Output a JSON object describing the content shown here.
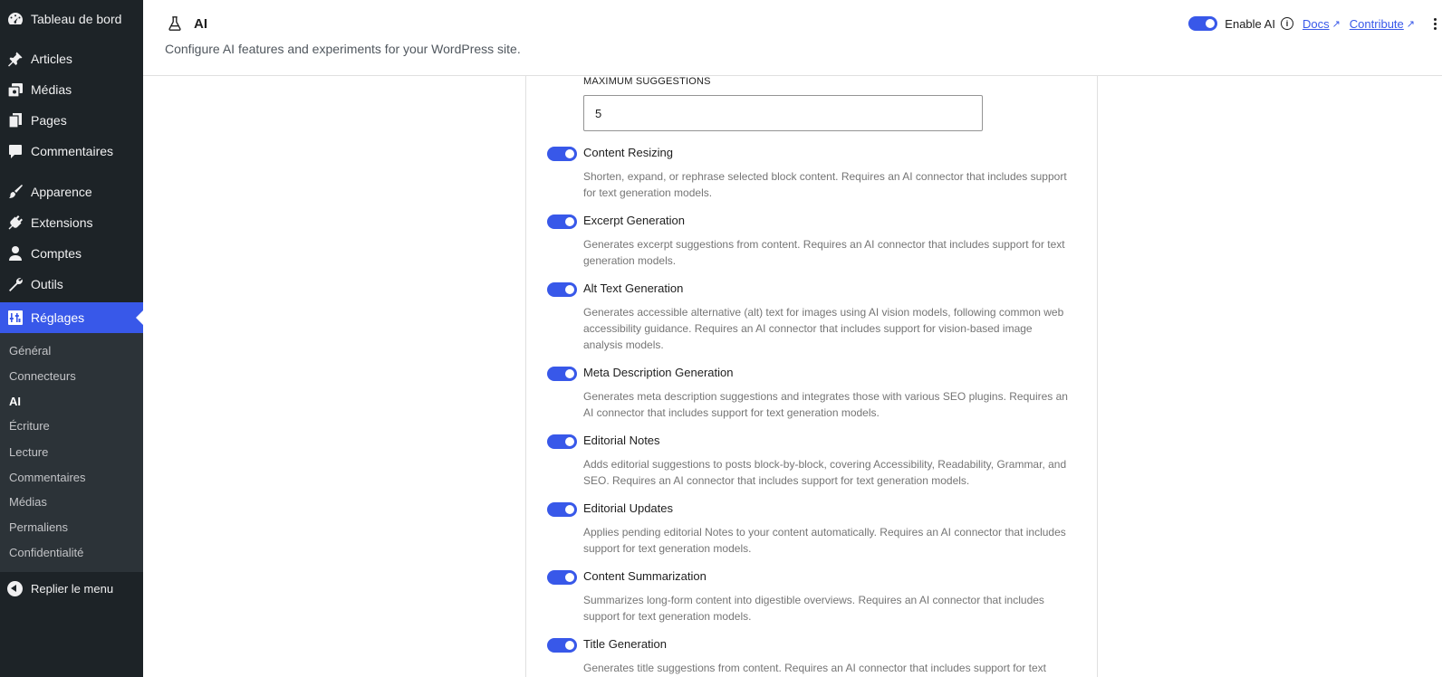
{
  "sidebar": {
    "items": [
      {
        "label": "Tableau de bord",
        "icon": "dashboard-icon"
      },
      {
        "label": "Articles",
        "icon": "pin-icon"
      },
      {
        "label": "Médias",
        "icon": "media-icon"
      },
      {
        "label": "Pages",
        "icon": "pages-icon"
      },
      {
        "label": "Commentaires",
        "icon": "comment-icon"
      },
      {
        "label": "Apparence",
        "icon": "brush-icon"
      },
      {
        "label": "Extensions",
        "icon": "plugin-icon"
      },
      {
        "label": "Comptes",
        "icon": "user-icon"
      },
      {
        "label": "Outils",
        "icon": "wrench-icon"
      },
      {
        "label": "Réglages",
        "icon": "settings-icon"
      }
    ],
    "submenu": [
      "Général",
      "Connecteurs",
      "AI",
      "Écriture",
      "Lecture",
      "Commentaires",
      "Médias",
      "Permaliens",
      "Confidentialité"
    ],
    "collapse_label": "Replier le menu"
  },
  "header": {
    "title": "AI",
    "description": "Configure AI features and experiments for your WordPress site.",
    "enable_ai_label": "Enable AI",
    "info_glyph": "i",
    "docs_label": "Docs",
    "contribute_label": "Contribute",
    "external_glyph": "↗"
  },
  "settings": {
    "max_suggestions_label": "MAXIMUM SUGGESTIONS",
    "max_suggestions_value": "5",
    "features": [
      {
        "title": "Content Resizing",
        "description": "Shorten, expand, or rephrase selected block content. Requires an AI connector that includes support for text generation models.",
        "enabled": true
      },
      {
        "title": "Excerpt Generation",
        "description": "Generates excerpt suggestions from content. Requires an AI connector that includes support for text generation models.",
        "enabled": true
      },
      {
        "title": "Alt Text Generation",
        "description": "Generates accessible alternative (alt) text for images using AI vision models, following common web accessibility guidance. Requires an AI connector that includes support for vision-based image analysis models.",
        "enabled": true
      },
      {
        "title": "Meta Description Generation",
        "description": "Generates meta description suggestions and integrates those with various SEO plugins. Requires an AI connector that includes support for text generation models.",
        "enabled": true
      },
      {
        "title": "Editorial Notes",
        "description": "Adds editorial suggestions to posts block-by-block, covering Accessibility, Readability, Grammar, and SEO. Requires an AI connector that includes support for text generation models.",
        "enabled": true
      },
      {
        "title": "Editorial Updates",
        "description": "Applies pending editorial Notes to your content automatically. Requires an AI connector that includes support for text generation models.",
        "enabled": true
      },
      {
        "title": "Content Summarization",
        "description": "Summarizes long-form content into digestible overviews. Requires an AI connector that includes support for text generation models.",
        "enabled": true
      },
      {
        "title": "Title Generation",
        "description": "Generates title suggestions from content. Requires an AI connector that includes support for text generation models.",
        "enabled": true
      }
    ]
  },
  "colors": {
    "accent": "#3858e9",
    "sidebar_bg": "#1d2327",
    "submenu_bg": "#2c3338"
  }
}
